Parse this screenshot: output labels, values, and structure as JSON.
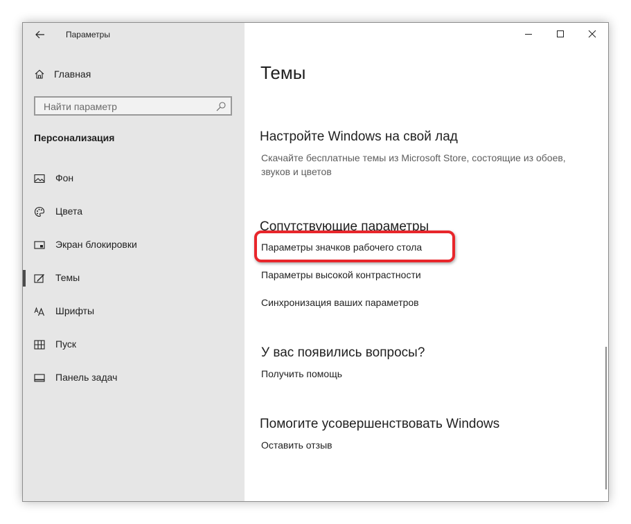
{
  "window": {
    "title": "Параметры",
    "controls": [
      "minimize-icon",
      "maximize-icon",
      "close-icon"
    ]
  },
  "sidebar": {
    "home_label": "Главная",
    "search": {
      "placeholder": "Найти параметр",
      "icon": "search-icon"
    },
    "section_title": "Персонализация",
    "items": [
      {
        "label": "Фон",
        "icon": "image-icon",
        "active": false
      },
      {
        "label": "Цвета",
        "icon": "palette-icon",
        "active": false
      },
      {
        "label": "Экран блокировки",
        "icon": "lock-screen-icon",
        "active": false
      },
      {
        "label": "Темы",
        "icon": "themes-icon",
        "active": true
      },
      {
        "label": "Шрифты",
        "icon": "fonts-icon",
        "active": false
      },
      {
        "label": "Пуск",
        "icon": "start-icon",
        "active": false
      },
      {
        "label": "Панель задач",
        "icon": "taskbar-icon",
        "active": false
      }
    ]
  },
  "main": {
    "page_title": "Темы",
    "customize": {
      "heading": "Настройте Windows на свой лад",
      "description": "Скачайте бесплатные темы из Microsoft Store, состоящие из обоев, звуков и цветов"
    },
    "related": {
      "heading": "Сопутствующие параметры",
      "links": [
        "Параметры значков рабочего стола",
        "Параметры высокой контрастности",
        "Синхронизация ваших параметров"
      ]
    },
    "questions": {
      "heading": "У вас появились вопросы?",
      "link": "Получить помощь"
    },
    "improve": {
      "heading": "Помогите усовершенствовать Windows",
      "link": "Оставить отзыв"
    }
  },
  "colors": {
    "sidebar_bg": "#e6e6e6",
    "highlight": "#e8262b",
    "text": "#1f1f1f",
    "secondary_text": "#5d5d5d"
  }
}
